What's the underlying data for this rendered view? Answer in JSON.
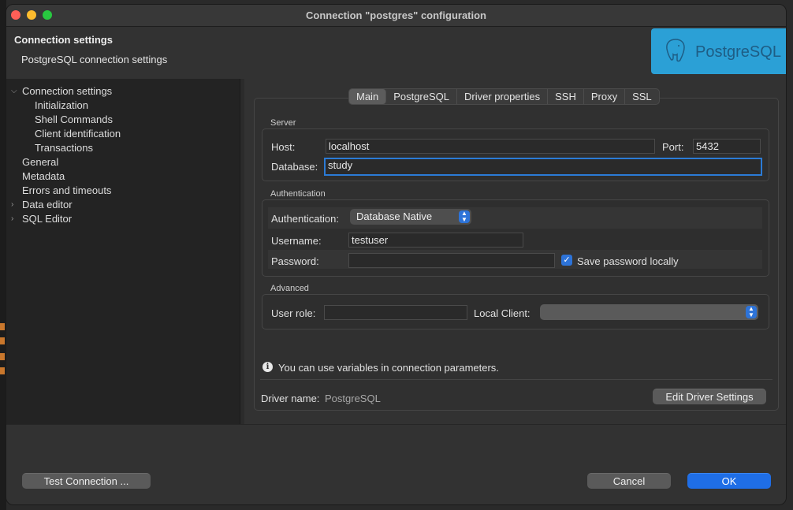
{
  "window": {
    "title": "Connection \"postgres\" configuration"
  },
  "header": {
    "title": "Connection settings",
    "subtitle": "PostgreSQL connection settings",
    "logo_text": "PostgreSQL"
  },
  "sidebar": {
    "items": [
      {
        "label": "Connection settings",
        "expanded": true
      },
      {
        "label": "Initialization"
      },
      {
        "label": "Shell Commands"
      },
      {
        "label": "Client identification"
      },
      {
        "label": "Transactions"
      },
      {
        "label": "General"
      },
      {
        "label": "Metadata"
      },
      {
        "label": "Errors and timeouts"
      },
      {
        "label": "Data editor",
        "expandable": true
      },
      {
        "label": "SQL Editor",
        "expandable": true
      }
    ]
  },
  "tabs": [
    "Main",
    "PostgreSQL",
    "Driver properties",
    "SSH",
    "Proxy",
    "SSL"
  ],
  "active_tab": "Main",
  "server": {
    "group_label": "Server",
    "host_label": "Host:",
    "host_value": "localhost",
    "port_label": "Port:",
    "port_value": "5432",
    "database_label": "Database:",
    "database_value": "study"
  },
  "auth": {
    "group_label": "Authentication",
    "auth_label": "Authentication:",
    "auth_value": "Database Native",
    "username_label": "Username:",
    "username_value": "testuser",
    "password_label": "Password:",
    "password_value": "",
    "save_password_label": "Save password locally",
    "save_password_checked": true
  },
  "advanced": {
    "group_label": "Advanced",
    "user_role_label": "User role:",
    "user_role_value": "",
    "local_client_label": "Local Client:",
    "local_client_value": ""
  },
  "info": {
    "text": "You can use variables in connection parameters."
  },
  "driver": {
    "name_label": "Driver name:",
    "name_value": "PostgreSQL",
    "edit_button": "Edit Driver Settings"
  },
  "footer": {
    "test_button": "Test Connection ...",
    "cancel_button": "Cancel",
    "ok_button": "OK"
  },
  "colors": {
    "accent": "#1f6ee6",
    "logo_bg": "#2ba0d6"
  }
}
